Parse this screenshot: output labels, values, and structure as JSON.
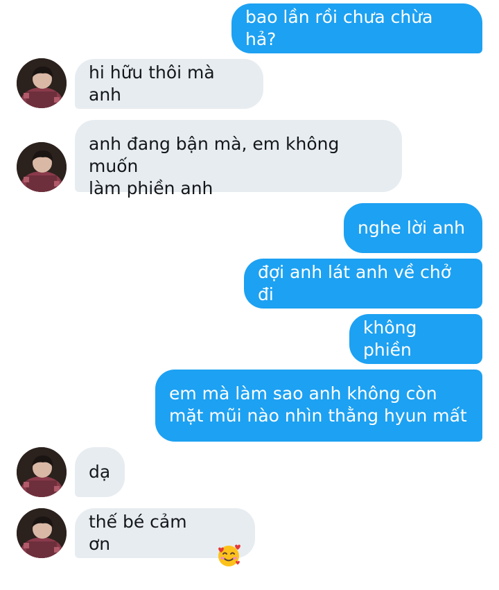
{
  "conversation": {
    "messages": [
      {
        "sender": "me",
        "text": "bao lần rồi chưa chừa hả?"
      },
      {
        "sender": "them",
        "text": "hi hữu thôi mà anh"
      },
      {
        "sender": "them",
        "text": "anh đang bận mà, em không muốn\nlàm phiền anh"
      },
      {
        "sender": "me",
        "text": "nghe lời anh"
      },
      {
        "sender": "me",
        "text": "đợi anh lát anh về chở đi"
      },
      {
        "sender": "me",
        "text": "không phiền"
      },
      {
        "sender": "me",
        "text": "em mà làm sao anh không còn\nmặt mũi nào nhìn thằng hyun mất"
      },
      {
        "sender": "them",
        "text": "dạ"
      },
      {
        "sender": "them",
        "text": "thế bé cảm ơn",
        "emoji": "smiling-face-with-hearts-icon"
      }
    ]
  },
  "colors": {
    "outgoing_bubble": "#1da1f2",
    "incoming_bubble": "#e7ecf0",
    "outgoing_text": "#ffffff",
    "incoming_text": "#14171a"
  }
}
